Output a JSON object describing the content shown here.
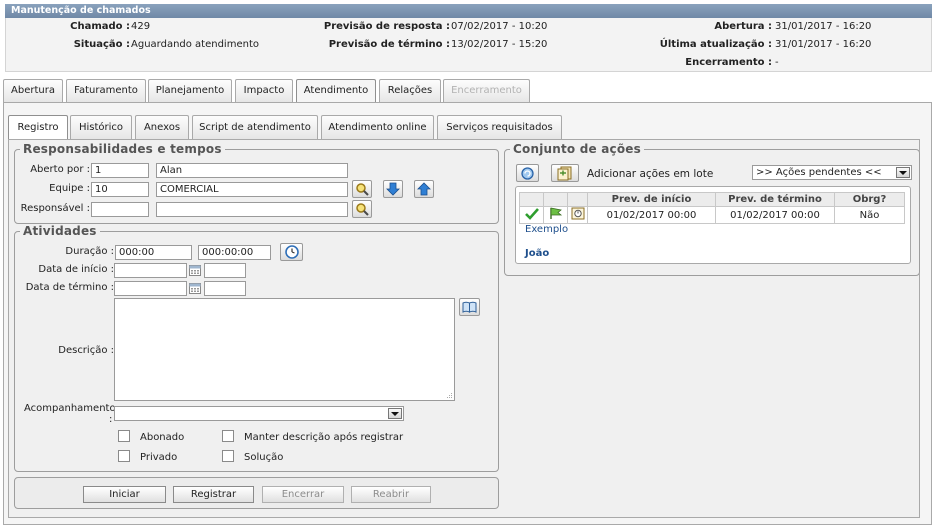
{
  "window": {
    "title": "Manutenção de chamados"
  },
  "header": {
    "chamado_label": "Chamado :",
    "chamado_value": "429",
    "situacao_label": "Situação :",
    "situacao_value": "Aguardando atendimento",
    "prev_resposta_label": "Previsão de resposta :",
    "prev_resposta_value": "07/02/2017 - 10:20",
    "prev_termino_label": "Previsão de término :",
    "prev_termino_value": "13/02/2017 - 15:20",
    "abertura_label": "Abertura :",
    "abertura_value": "31/01/2017 - 16:20",
    "ultima_label": "Última atualização :",
    "ultima_value": "31/01/2017 - 16:20",
    "encerramento_label": "Encerramento :",
    "encerramento_value": "-"
  },
  "main_tabs": [
    "Abertura",
    "Faturamento",
    "Planejamento",
    "Impacto",
    "Atendimento",
    "Relações",
    "Encerramento"
  ],
  "sub_tabs": [
    "Registro",
    "Histórico",
    "Anexos",
    "Script de atendimento",
    "Atendimento online",
    "Serviços requisitados"
  ],
  "responsabilidades": {
    "legend": "Responsabilidades e tempos",
    "aberto_label": "Aberto por :",
    "aberto_code": "1",
    "aberto_name": "Alan",
    "equipe_label": "Equipe :",
    "equipe_code": "10",
    "equipe_name": "COMERCIAL",
    "responsavel_label": "Responsável :",
    "responsavel_code": "",
    "responsavel_name": ""
  },
  "atividades": {
    "legend": "Atividades",
    "duracao_label": "Duração :",
    "duracao_value1": "000:00",
    "duracao_value2": "000:00:00",
    "data_inicio_label": "Data de início :",
    "data_termino_label": "Data de término :",
    "descricao_label": "Descrição :",
    "acompanhamento_label": "Acompanhamento",
    "acompanhamento_colon": ":",
    "abonado_label": "Abonado",
    "manter_label": "Manter descrição após registrar",
    "privado_label": "Privado",
    "solucao_label": "Solução"
  },
  "buttons": {
    "iniciar": "Iniciar",
    "registrar": "Registrar",
    "encerrar": "Encerrar",
    "reabrir": "Reabrir"
  },
  "conjunto": {
    "legend": "Conjunto de ações",
    "adicionar_label": "Adicionar ações em lote",
    "select_value": ">> Ações pendentes <<",
    "columns": [
      "Prev. de início",
      "Prev. de término",
      "Obrg?"
    ],
    "row": {
      "inicio": "01/02/2017 00:00",
      "termino": "01/02/2017 00:00",
      "obrg": "Não"
    },
    "name_line1": "Exemplo",
    "name_line2": "João"
  },
  "colors": {
    "title_bar": "#7d95b2",
    "link": "#1e4f8c",
    "check_green": "#2f9e2f"
  }
}
